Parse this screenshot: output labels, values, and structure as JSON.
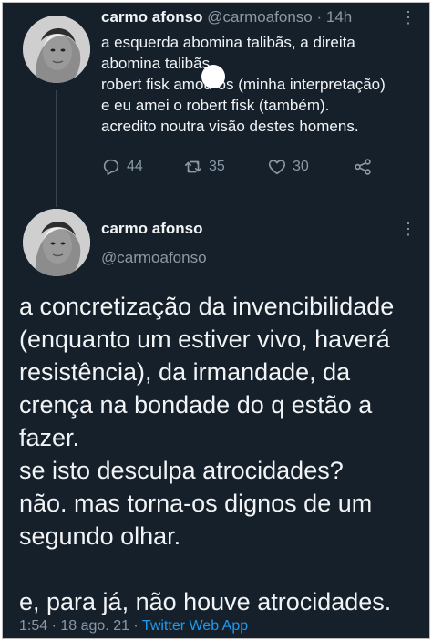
{
  "tweet1": {
    "author_name": "carmo afonso",
    "author_handle": "@carmoafonso",
    "separator": "·",
    "time": "14h",
    "lines": [
      "a esquerda abomina talibãs, a direita",
      "abomina talibãs",
      "robert fisk amou-os (minha interpretação)",
      "e eu amei o robert fisk (também).",
      "acredito noutra visão destes homens."
    ],
    "replies": "44",
    "retweets": "35",
    "likes": "30"
  },
  "tweet2": {
    "author_name": "carmo afonso",
    "author_handle": "@carmoafonso",
    "lines": [
      "a concretização da invencibilidade",
      "(enquanto um estiver vivo, haverá",
      "resistência), da irmandade, da",
      "crença na bondade do q estão a",
      "fazer.",
      "se isto desculpa atrocidades?",
      "não. mas torna-os dignos de um",
      "segundo olhar.",
      "",
      "e, para já, não houve atrocidades."
    ],
    "timestamp": "1:54 · 18 ago. 21 ·",
    "source": "Twitter Web App"
  },
  "icons": {
    "more": "more-icon",
    "reply": "reply-icon",
    "retweet": "retweet-icon",
    "like": "heart-icon",
    "share": "share-icon"
  },
  "colors": {
    "background": "#15202b",
    "text": "#f1f3f5",
    "muted": "#8b98a5",
    "link": "#1d9bf0"
  }
}
